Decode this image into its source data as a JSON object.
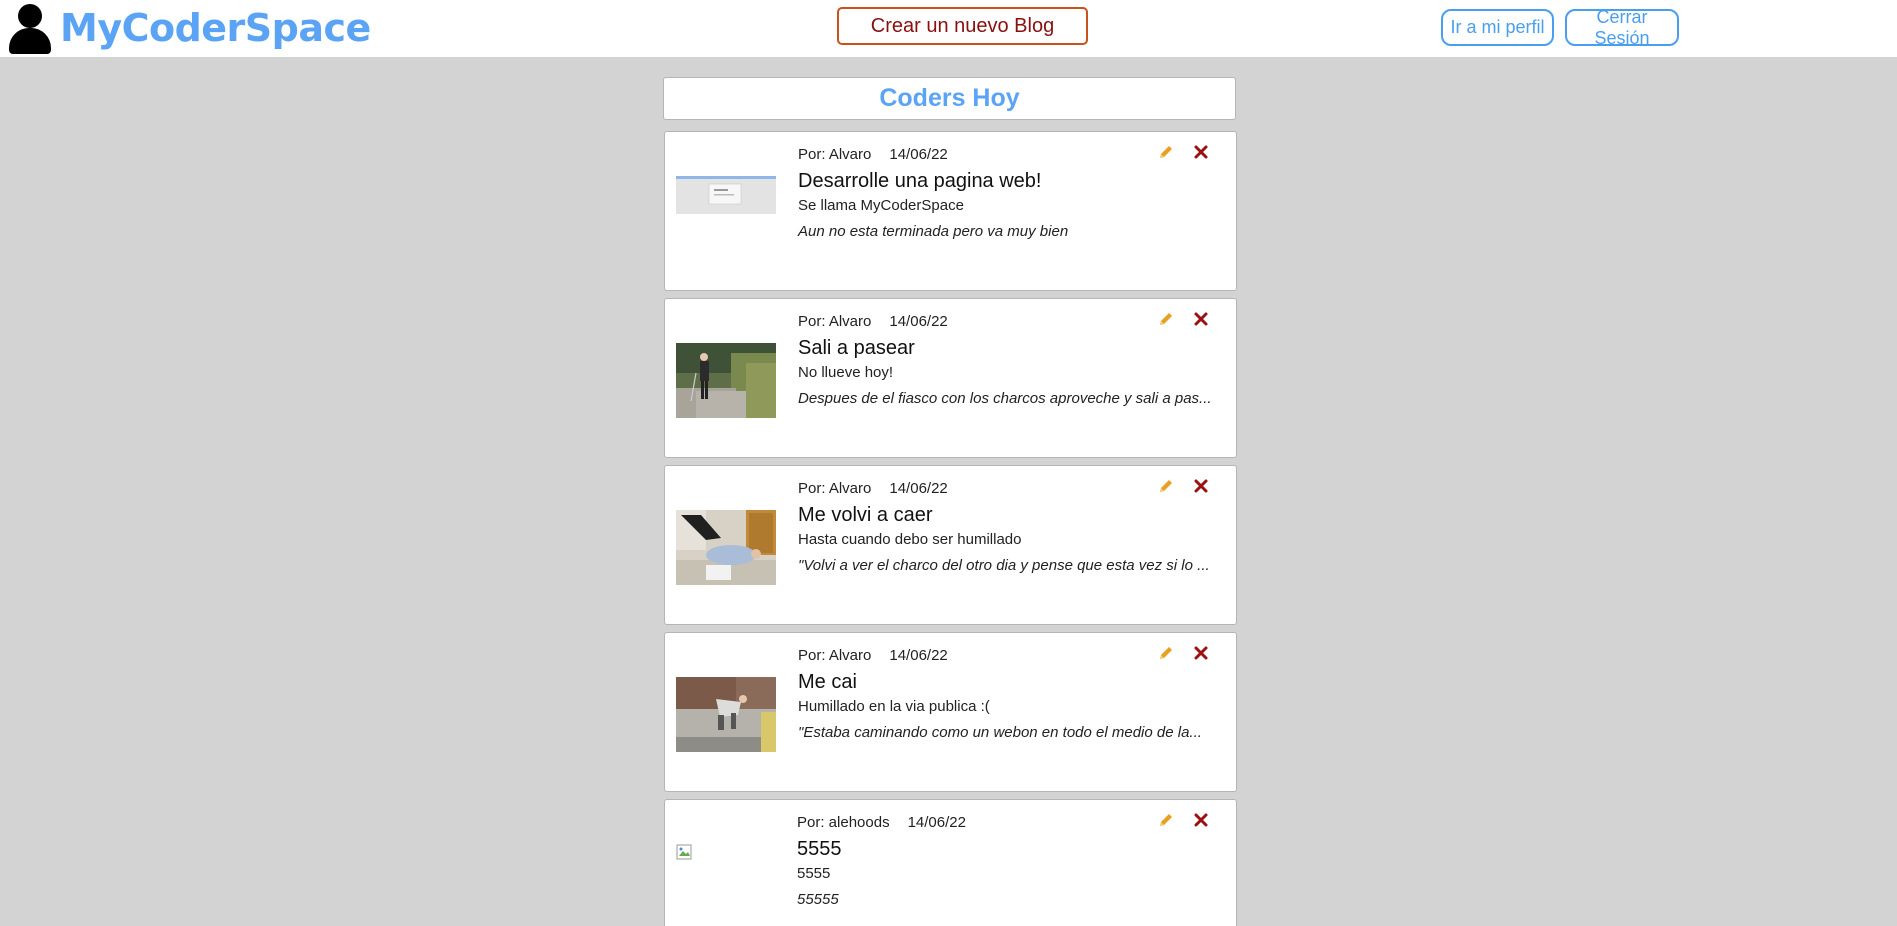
{
  "navbar": {
    "brand": "MyCoderSpace",
    "create_blog": "Crear un nuevo Blog",
    "profile": "Ir a mi perfil",
    "logout": "Cerrar Sesión"
  },
  "feed": {
    "title": "Coders Hoy",
    "posts": [
      {
        "author": "Por: Alvaro",
        "date": "14/06/22",
        "title": "Desarrolle una pagina web!",
        "subtitle": "Se llama MyCoderSpace",
        "excerpt": "Aun no esta terminada pero va muy bien",
        "image": "website-screenshot"
      },
      {
        "author": "Por: Alvaro",
        "date": "14/06/22",
        "title": "Sali a pasear",
        "subtitle": "No llueve hoy!",
        "excerpt": "Despues de el fiasco con los charcos aproveche y sali a pas...",
        "image": "elderly-man-walking-photo"
      },
      {
        "author": "Por: Alvaro",
        "date": "14/06/22",
        "title": "Me volvi a caer",
        "subtitle": "Hasta cuando debo ser humillado",
        "excerpt": "\"Volvi a ver el charco del otro dia y pense que esta vez si lo ...",
        "image": "man-fallen-indoors-photo"
      },
      {
        "author": "Por: Alvaro",
        "date": "14/06/22",
        "title": "Me cai",
        "subtitle": "Humillado en la via publica :(",
        "excerpt": "\"Estaba caminando como un webon en todo el medio de la...",
        "image": "man-fallen-street-photo"
      },
      {
        "author": "Por: alehoods",
        "date": "14/06/22",
        "title": "5555",
        "subtitle": "5555",
        "excerpt": "55555",
        "image": "broken-image-icon"
      }
    ]
  },
  "colors": {
    "brand": "#5aa3f5",
    "background": "#d3d3d3",
    "create_border": "#c9511a",
    "create_text": "#8a0f0f",
    "edit_icon": "#e8a020",
    "delete_icon": "#9b1111"
  }
}
